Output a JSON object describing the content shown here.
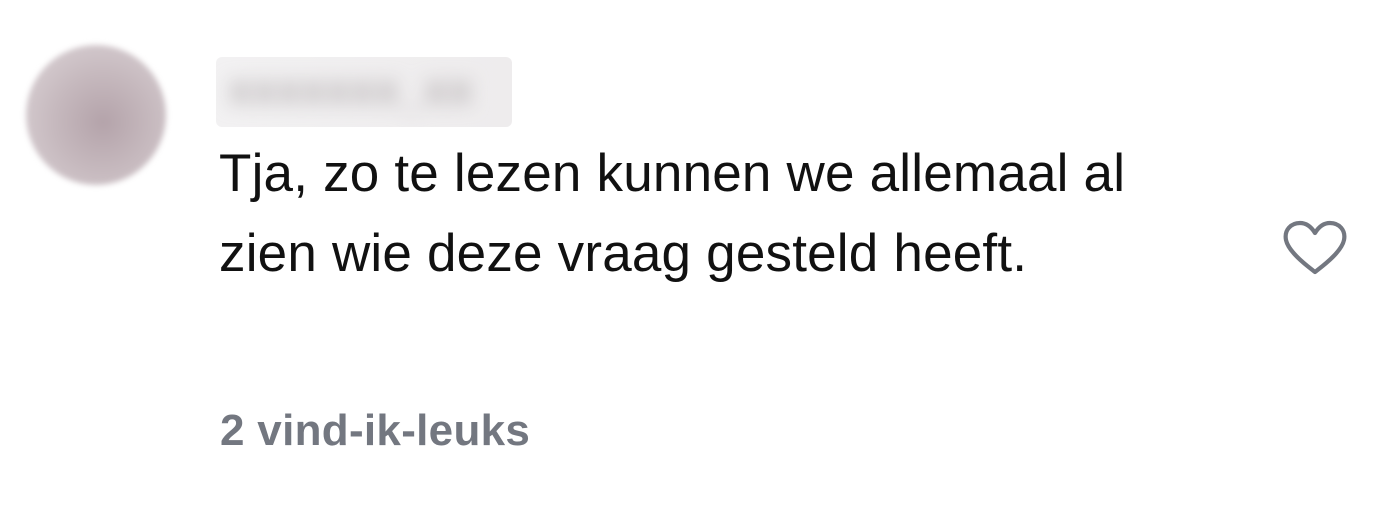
{
  "comment": {
    "username": "xxxxxxx_xx",
    "text": "Tja, zo te lezen kunnen we allemaal al zien wie deze vraag gesteld heeft.",
    "likes_label": "2 vind-ik-leuks",
    "like_icon": "heart-outline-icon",
    "avatar_icon": "user-avatar"
  },
  "colors": {
    "text": "#111111",
    "likes": "#737780",
    "icon": "#737780"
  }
}
